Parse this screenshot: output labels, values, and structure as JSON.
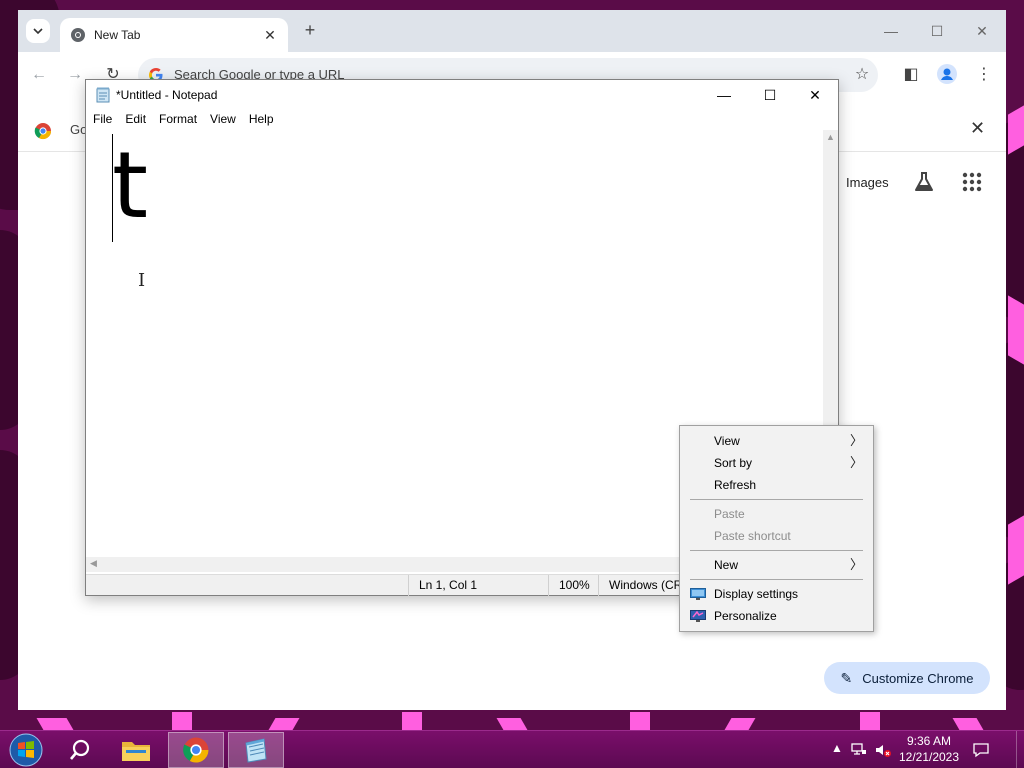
{
  "chrome": {
    "tab_title": "New Tab",
    "omnibox_placeholder": "Search Google or type a URL",
    "bar2_text": "Go",
    "images_link": "Images",
    "customize_label": "Customize Chrome"
  },
  "notepad": {
    "title": "*Untitled - Notepad",
    "menu": [
      "File",
      "Edit",
      "Format",
      "View",
      "Help"
    ],
    "content": "t",
    "status": {
      "position": "Ln 1, Col 1",
      "zoom": "100%",
      "line_ending": "Windows (CRL"
    }
  },
  "context_menu": {
    "items": [
      {
        "label": "View",
        "submenu": true,
        "disabled": false
      },
      {
        "label": "Sort by",
        "submenu": true,
        "disabled": false
      },
      {
        "label": "Refresh",
        "submenu": false,
        "disabled": false
      },
      {
        "label": "Paste",
        "submenu": false,
        "disabled": true
      },
      {
        "label": "Paste shortcut",
        "submenu": false,
        "disabled": true
      },
      {
        "label": "New",
        "submenu": true,
        "disabled": false
      },
      {
        "label": "Display settings",
        "submenu": false,
        "disabled": false,
        "icon": "display-icon"
      },
      {
        "label": "Personalize",
        "submenu": false,
        "disabled": false,
        "icon": "personalize-icon"
      }
    ]
  },
  "taskbar": {
    "time": "9:36 AM",
    "date": "12/21/2023"
  },
  "colors": {
    "wallpaper": "#5a0c48",
    "wallpaper_accent": "#ff5fe0",
    "taskbar": "#7a0e6a",
    "chrome_tabstrip": "#dee3ea",
    "customize_button": "#d3e3fd"
  }
}
